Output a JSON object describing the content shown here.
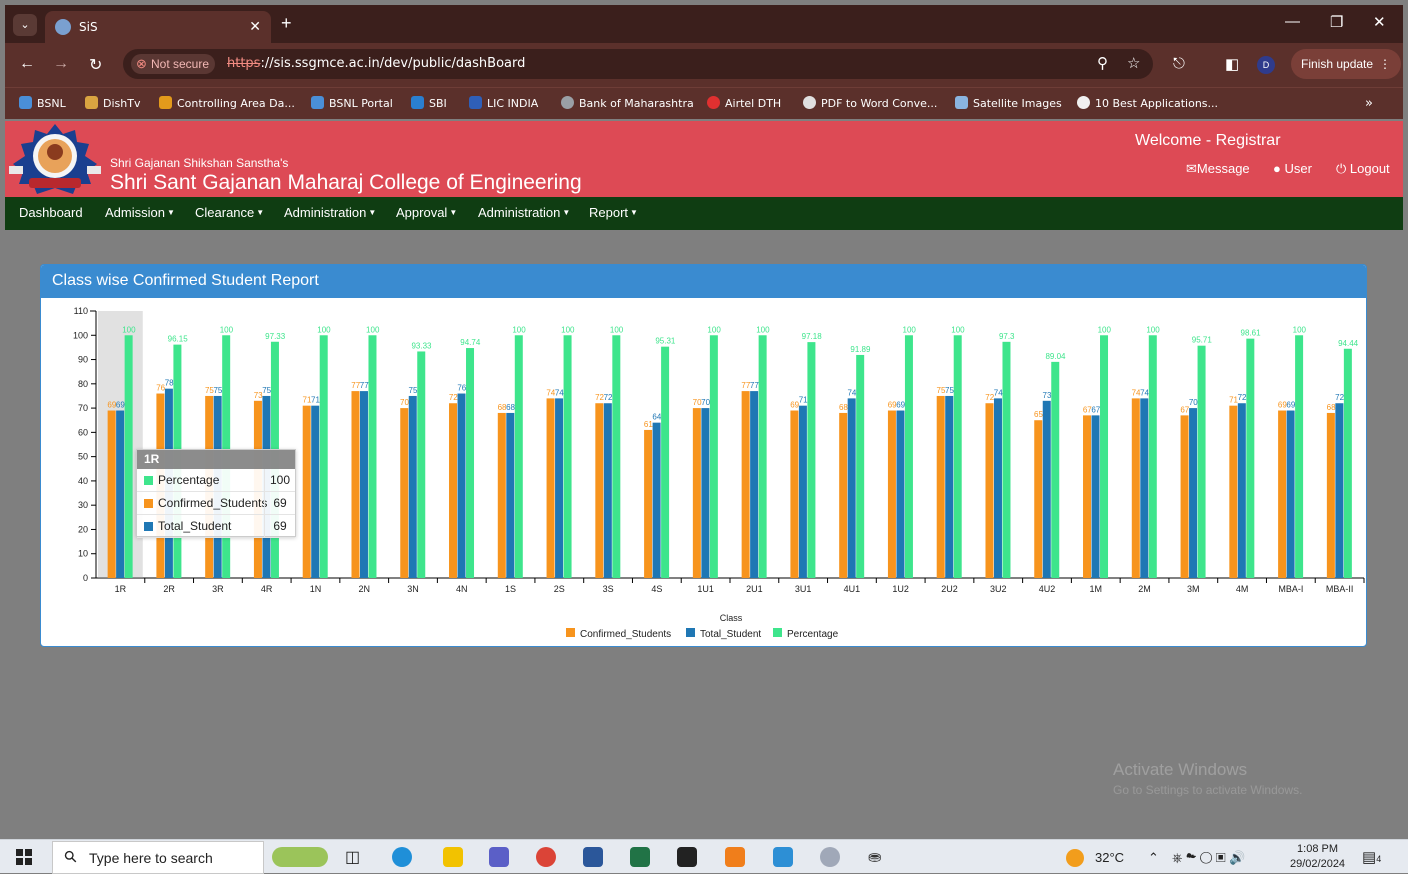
{
  "browser": {
    "tab_title": "SiS",
    "not_secure": "Not secure",
    "url_scheme": "https",
    "url_rest": "://sis.ssgmce.ac.in/dev/public/dashBoard",
    "profile_initial": "D",
    "finish_update": "Finish update",
    "bookmarks": [
      "BSNL",
      "DishTv",
      "Controlling Area Da...",
      "BSNL Portal",
      "SBI",
      "LIC INDIA",
      "Bank of Maharashtra",
      "Airtel DTH",
      "PDF to Word Conve...",
      "Satellite Images",
      "10 Best Applications..."
    ]
  },
  "header": {
    "sanstha": "Shri Gajanan Shikshan Sanstha's",
    "college": "Shri Sant Gajanan Maharaj College of Engineering",
    "welcome": "Welcome - Registrar",
    "message": "Message",
    "user": "User",
    "logout": "Logout"
  },
  "menu": [
    "Dashboard",
    "Admission",
    "Clearance",
    "Administration",
    "Approval",
    "Administration",
    "Report"
  ],
  "panel_title": "Class wise Confirmed Student Report",
  "chart_data": {
    "type": "bar",
    "xlabel": "Class",
    "ylabel": "",
    "ylim": [
      0,
      110
    ],
    "yticks": [
      0,
      10,
      20,
      30,
      40,
      50,
      60,
      70,
      80,
      90,
      100,
      110
    ],
    "categories": [
      "1R",
      "2R",
      "3R",
      "4R",
      "1N",
      "2N",
      "3N",
      "4N",
      "1S",
      "2S",
      "3S",
      "4S",
      "1U1",
      "2U1",
      "3U1",
      "4U1",
      "1U2",
      "2U2",
      "3U2",
      "4U2",
      "1M",
      "2M",
      "3M",
      "4M",
      "MBA-I",
      "MBA-II"
    ],
    "series": [
      {
        "name": "Confirmed_Students",
        "color": "#f7941d",
        "values": [
          69,
          76,
          75,
          73,
          71,
          77,
          70,
          72,
          68,
          74,
          72,
          61,
          70,
          77,
          69,
          68,
          69,
          75,
          72,
          65,
          67,
          74,
          67,
          71,
          69,
          68
        ]
      },
      {
        "name": "Total_Student",
        "color": "#1f77b4",
        "values": [
          69,
          78,
          75,
          75,
          71,
          77,
          75,
          76,
          68,
          74,
          72,
          64,
          70,
          77,
          71,
          74,
          69,
          75,
          74,
          73,
          67,
          74,
          70,
          72,
          69,
          72
        ]
      },
      {
        "name": "Percentage",
        "color": "#3ee58c",
        "values": [
          100,
          96.15,
          100,
          97.33,
          100,
          100,
          93.33,
          94.74,
          100,
          100,
          100,
          95.31,
          100,
          100,
          97.18,
          91.89,
          100,
          100,
          97.3,
          89.04,
          100,
          100,
          95.71,
          98.61,
          100,
          94.44
        ]
      }
    ],
    "legend_position": "bottom"
  },
  "tooltip": {
    "title": "1R",
    "rows": [
      {
        "label": "Percentage",
        "value": "100"
      },
      {
        "label": "Confirmed_Students",
        "value": "69"
      },
      {
        "label": "Total_Student",
        "value": "69"
      }
    ]
  },
  "watermark": {
    "line1": "Activate Windows",
    "line2": "Go to Settings to activate Windows."
  },
  "taskbar": {
    "search_placeholder": "Type here to search",
    "temperature": "32°C",
    "time": "1:08 PM",
    "date": "29/02/2024",
    "notification_count": "4"
  }
}
